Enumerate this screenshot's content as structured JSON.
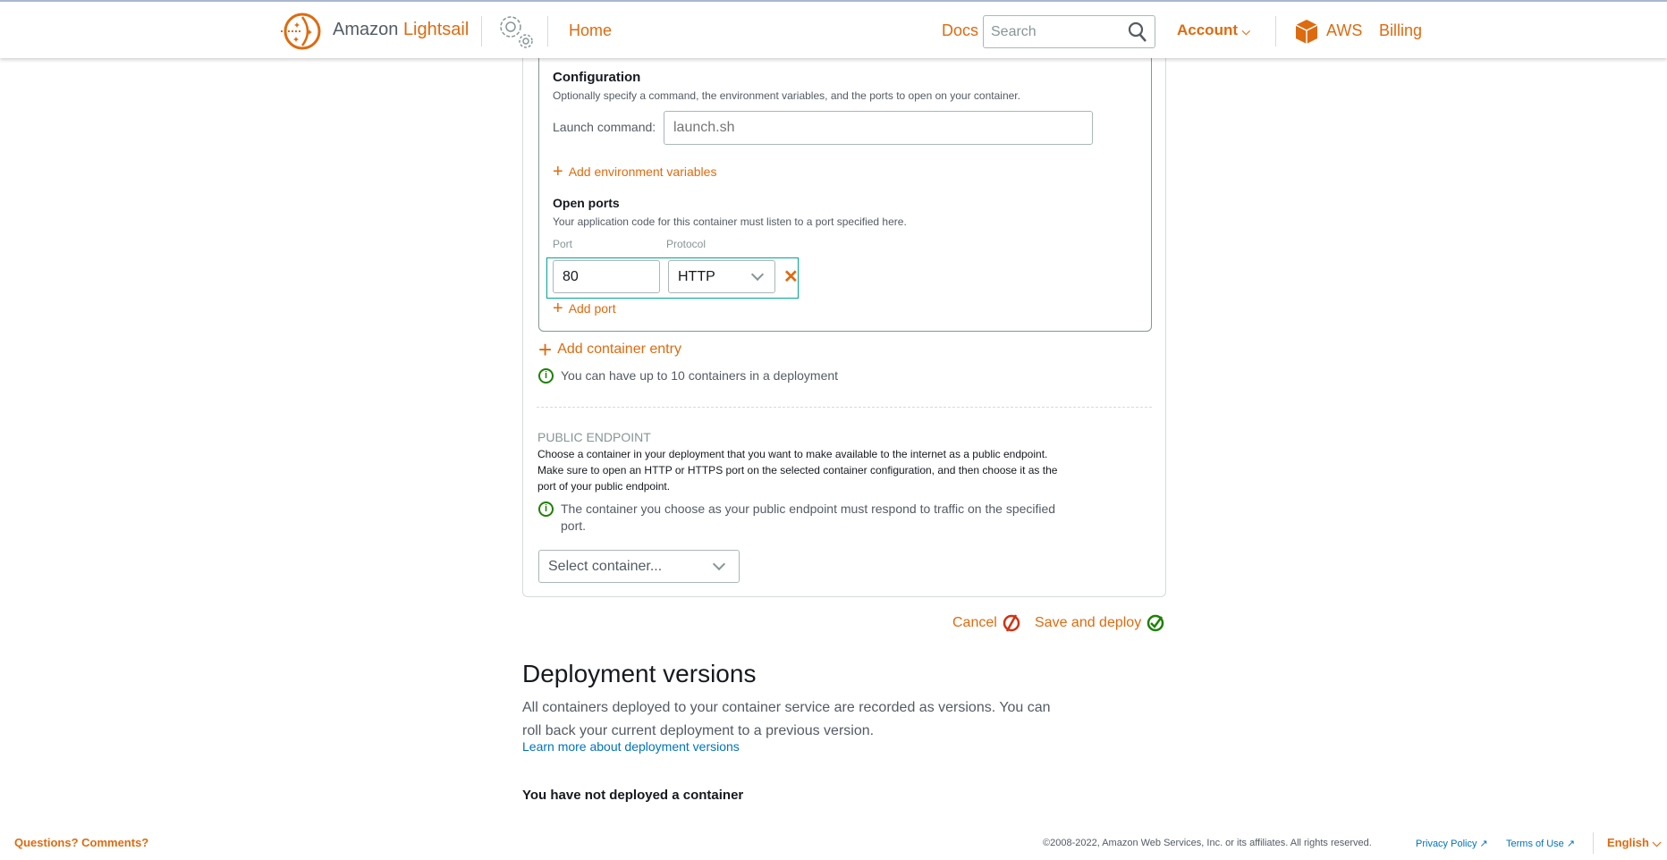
{
  "header": {
    "brand_prefix": "Amazon",
    "brand_name": "Lightsail",
    "home": "Home",
    "docs": "Docs",
    "search_placeholder": "Search",
    "account": "Account",
    "aws": "AWS",
    "billing": "Billing"
  },
  "configuration": {
    "title": "Configuration",
    "description": "Optionally specify a command, the environment variables, and the ports to open on your container.",
    "launch_label": "Launch command:",
    "launch_placeholder": "launch.sh",
    "add_env": "Add environment variables"
  },
  "ports": {
    "title": "Open ports",
    "description": "Your application code for this container must listen to a port specified here.",
    "port_label": "Port",
    "protocol_label": "Protocol",
    "port_value": "80",
    "protocol_value": "HTTP",
    "add_port": "Add port"
  },
  "add_container": "Add container entry",
  "container_limit_info": "You can have up to 10 containers in a deployment",
  "endpoint": {
    "title": "PUBLIC ENDPOINT",
    "line1": "Choose a container in your deployment that you want to make available to the internet as a public endpoint.",
    "line2": "Make sure to open an HTTP or HTTPS port on the selected container configuration, and then choose it as the",
    "line3": "port of your public endpoint.",
    "info": "The container you choose as your public endpoint must respond to traffic on the specified port.",
    "select_placeholder": "Select container..."
  },
  "actions": {
    "cancel": "Cancel",
    "save": "Save and deploy"
  },
  "versions": {
    "title": "Deployment versions",
    "description": "All containers deployed to your container service are recorded as versions. You can roll back your current deployment to a previous version.",
    "learn_more": "Learn more about deployment versions",
    "empty": "You have not deployed a container"
  },
  "footer": {
    "feedback": "Questions? Comments?",
    "copyright": "©2008-2022, Amazon Web Services, Inc. or its affiliates. All rights reserved.",
    "privacy": "Privacy Policy",
    "terms": "Terms of Use",
    "language": "English"
  },
  "colors": {
    "accent": "#dd6b10",
    "link": "#0073bb",
    "info": "#1d8102",
    "highlight": "#00a591"
  }
}
